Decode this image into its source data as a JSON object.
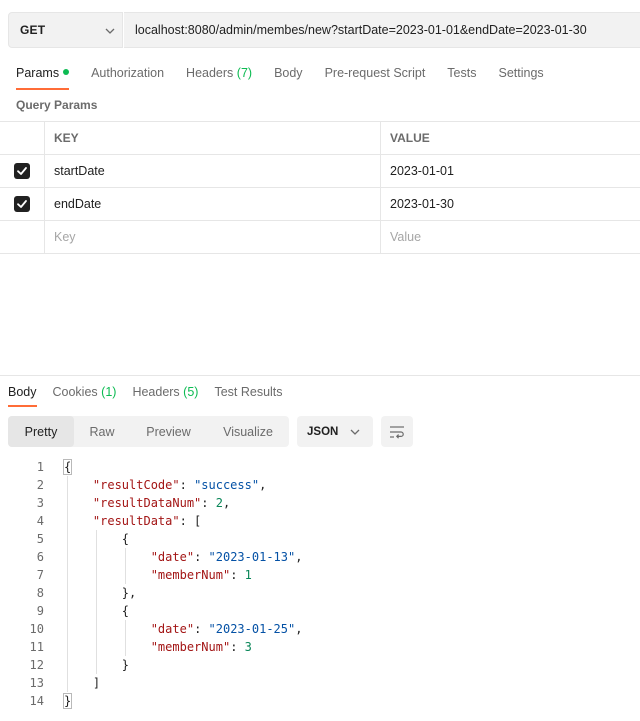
{
  "request": {
    "method": "GET",
    "url": "localhost:8080/admin/membes/new?startDate=2023-01-01&endDate=2023-01-30"
  },
  "request_tabs": [
    {
      "label": "Params",
      "active": true,
      "dot": true
    },
    {
      "label": "Authorization"
    },
    {
      "label": "Headers",
      "count": "(7)"
    },
    {
      "label": "Body"
    },
    {
      "label": "Pre-request Script"
    },
    {
      "label": "Tests"
    },
    {
      "label": "Settings"
    }
  ],
  "query_params": {
    "title": "Query Params",
    "headers": {
      "key": "KEY",
      "value": "VALUE"
    },
    "rows": [
      {
        "checked": true,
        "key": "startDate",
        "value": "2023-01-01"
      },
      {
        "checked": true,
        "key": "endDate",
        "value": "2023-01-30"
      }
    ],
    "placeholder": {
      "key": "Key",
      "value": "Value"
    }
  },
  "response_tabs": [
    {
      "label": "Body",
      "active": true
    },
    {
      "label": "Cookies",
      "count": "(1)"
    },
    {
      "label": "Headers",
      "count": "(5)"
    },
    {
      "label": "Test Results"
    }
  ],
  "view_modes": [
    "Pretty",
    "Raw",
    "Preview",
    "Visualize"
  ],
  "active_view": "Pretty",
  "format": "JSON",
  "code_lines": [
    [
      [
        "p",
        "{"
      ]
    ],
    [
      [
        "p",
        "    "
      ],
      [
        "k",
        "\"resultCode\""
      ],
      [
        "p",
        ": "
      ],
      [
        "s",
        "\"success\""
      ],
      [
        "p",
        ","
      ]
    ],
    [
      [
        "p",
        "    "
      ],
      [
        "k",
        "\"resultDataNum\""
      ],
      [
        "p",
        ": "
      ],
      [
        "n",
        "2"
      ],
      [
        "p",
        ","
      ]
    ],
    [
      [
        "p",
        "    "
      ],
      [
        "k",
        "\"resultData\""
      ],
      [
        "p",
        ": ["
      ]
    ],
    [
      [
        "p",
        "        {"
      ]
    ],
    [
      [
        "p",
        "            "
      ],
      [
        "k",
        "\"date\""
      ],
      [
        "p",
        ": "
      ],
      [
        "s",
        "\"2023-01-13\""
      ],
      [
        "p",
        ","
      ]
    ],
    [
      [
        "p",
        "            "
      ],
      [
        "k",
        "\"memberNum\""
      ],
      [
        "p",
        ": "
      ],
      [
        "n",
        "1"
      ]
    ],
    [
      [
        "p",
        "        },"
      ]
    ],
    [
      [
        "p",
        "        {"
      ]
    ],
    [
      [
        "p",
        "            "
      ],
      [
        "k",
        "\"date\""
      ],
      [
        "p",
        ": "
      ],
      [
        "s",
        "\"2023-01-25\""
      ],
      [
        "p",
        ","
      ]
    ],
    [
      [
        "p",
        "            "
      ],
      [
        "k",
        "\"memberNum\""
      ],
      [
        "p",
        ": "
      ],
      [
        "n",
        "3"
      ]
    ],
    [
      [
        "p",
        "        }"
      ]
    ],
    [
      [
        "p",
        "    ]"
      ]
    ],
    [
      [
        "p",
        "}"
      ]
    ]
  ],
  "colors": {
    "accent": "#ff6c37",
    "status_dot": "#0cbb52",
    "json_key": "#a31515",
    "json_string": "#0451a5",
    "json_number": "#098658"
  }
}
